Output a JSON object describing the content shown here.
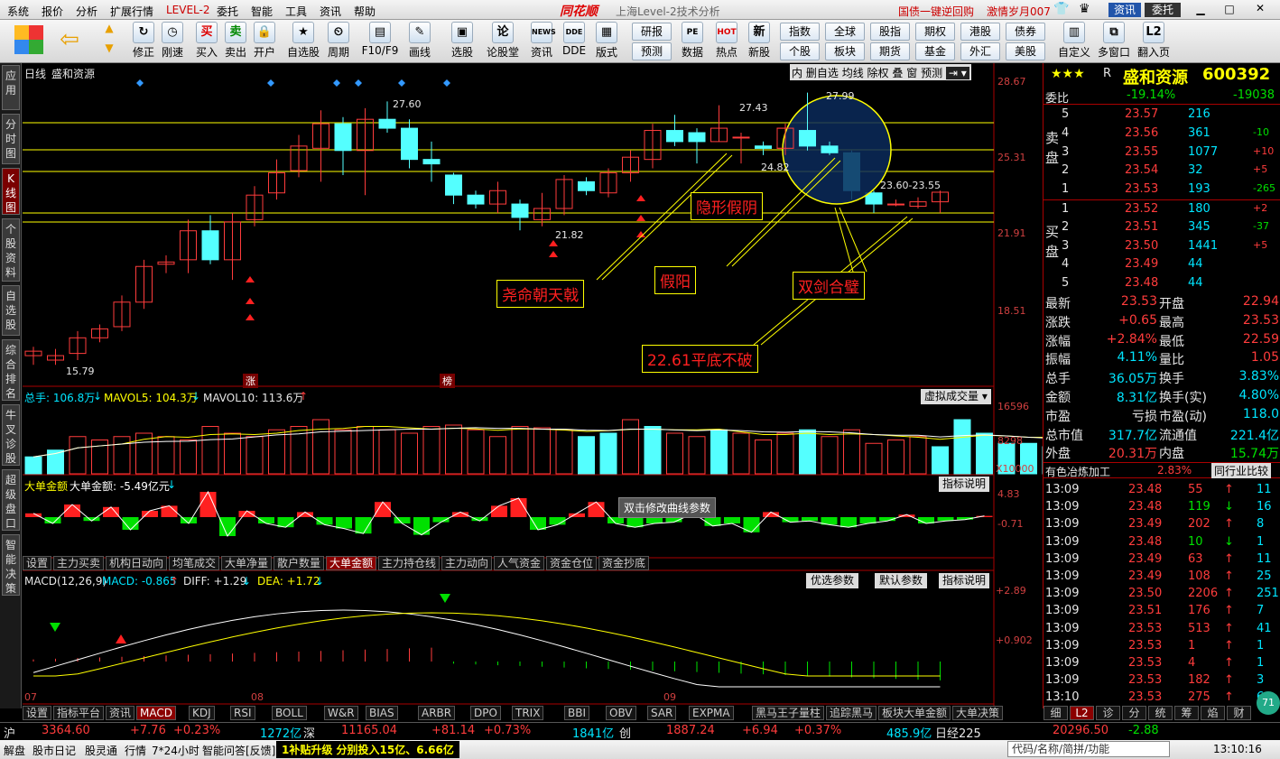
{
  "menubar": {
    "items": [
      "系统",
      "报价",
      "分析",
      "扩展行情",
      "LEVEL-2",
      "委托",
      "智能",
      "工具",
      "资讯",
      "帮助"
    ],
    "brand": "同花顺",
    "window_title": "上海Level-2技术分析",
    "promo1": "国债一键逆回购",
    "promo2": "激情岁月007",
    "btn_info": "资讯",
    "btn_trade": "委托"
  },
  "toolbar": {
    "buttons": [
      "修正",
      "刚速",
      "买入",
      "卖出",
      "开户",
      "自选股",
      "周期",
      "F10/F9",
      "画线",
      "选股",
      "论股堂",
      "资讯",
      "DDE",
      "版式",
      "数据",
      "热点",
      "新股"
    ],
    "small_buttons": [
      "研报",
      "预测",
      "指数",
      "全球",
      "股指",
      "期权",
      "港股",
      "债券",
      "个股",
      "板块",
      "期货",
      "基金",
      "外汇",
      "美股"
    ],
    "right_buttons": [
      "自定义",
      "多窗口",
      "翻入页"
    ]
  },
  "sidetabs": [
    "应用",
    "分时图",
    "K线图",
    "个股资料",
    "自选股",
    "综合排名",
    "牛叉诊股",
    "超级盘口",
    "智能决策"
  ],
  "kchart": {
    "period_label": "日线",
    "stock_name": "盛和资源",
    "top_buttons": [
      "内",
      "删自选",
      "均线",
      "除权",
      "叠",
      "窗",
      "预测"
    ],
    "y_ticks": [
      "28.67",
      "25.31",
      "21.91",
      "18.51"
    ],
    "price_labels": [
      "27.60",
      "27.43",
      "27.99",
      "24.82",
      "21.82",
      "15.79",
      "23.60-23.55"
    ],
    "markers": [
      "涨",
      "榜"
    ],
    "annotations": [
      "隐形假阴",
      "尧命朝天戟",
      "假阳",
      "双剑合璧",
      "22.61平底不破"
    ]
  },
  "volume": {
    "label": "总手: 106.8万",
    "mavol5": "MAVOL5: 104.3万",
    "mavol10": "MAVOL10: 113.6万",
    "button": "虚拟成交量",
    "y_ticks": [
      "16596",
      "8298",
      "X10000"
    ],
    "values": [
      2.5,
      3.5,
      5.5,
      5.0,
      5.5,
      6.0,
      5.5,
      5.0,
      7.0,
      6.0,
      5.5,
      6.5,
      7.0,
      8.0,
      6.5,
      7.0,
      6.5,
      6.0,
      7.0,
      7.2,
      6.5,
      5.5,
      7.0,
      6.8,
      6.5,
      5.5,
      6.0,
      8.0,
      7.0,
      6.0,
      5.5,
      6.5,
      6.0,
      5.0,
      6.0,
      6.5,
      5.5,
      6.5,
      4.5,
      5.0,
      5.5,
      4.0,
      8.0,
      6.0,
      4.5,
      4.5,
      4.0,
      2.5,
      2.5,
      2.0
    ],
    "colors": [
      "c",
      "c",
      "r",
      "r",
      "r",
      "r",
      "r",
      "r",
      "r",
      "r",
      "r",
      "r",
      "r",
      "r",
      "r",
      "r",
      "r",
      "r",
      "r",
      "r",
      "r",
      "r",
      "r",
      "r",
      "r",
      "c",
      "c",
      "r",
      "c",
      "r",
      "r",
      "c",
      "r",
      "r",
      "r",
      "c",
      "r",
      "r",
      "r",
      "r",
      "r",
      "c",
      "c",
      "c",
      "c",
      "c",
      "c",
      "c",
      "r",
      "r"
    ]
  },
  "bigorder": {
    "label": "大单金额",
    "value": "大单金额: -5.49亿元",
    "button": "指标说明",
    "y_ticks": [
      "4.83",
      "-0.71"
    ],
    "tooltip": "双击修改曲线参数",
    "values": [
      0.3,
      -0.5,
      1.0,
      -0.3,
      0.8,
      -1.0,
      0.5,
      0.9,
      -0.5,
      2.0,
      -1.5,
      0.5,
      -0.5,
      -0.8,
      0.4,
      -0.6,
      -0.9,
      -1.3,
      1.2,
      -0.5,
      -1.4,
      -0.4,
      0.4,
      -0.3,
      0.9,
      1.5,
      -1.0,
      -0.6,
      0.3,
      1.2,
      -0.5,
      -0.8,
      -0.5,
      -0.4,
      0.3,
      -0.7,
      -0.5,
      -1.2,
      0.4,
      -0.4,
      -0.3,
      -0.6,
      -0.8,
      -0.5,
      -0.3,
      0.2,
      -0.5,
      -0.3,
      -0.2,
      0.1
    ],
    "tabs": [
      "设置",
      "主力买卖",
      "机构日动向",
      "均笔成交",
      "大单净量",
      "散户数量",
      "大单金额",
      "主力持仓线",
      "主力动向",
      "人气资金",
      "资金仓位",
      "资金抄底"
    ]
  },
  "macd": {
    "label": "MACD(12,26,9)",
    "macd": "MACD: -0.865",
    "diff": "DIFF: +1.29",
    "dea": "DEA: +1.72",
    "buttons": [
      "优选参数",
      "默认参数",
      "指标说明"
    ],
    "y_ticks": [
      "+2.89",
      "+0.902"
    ],
    "dates": [
      "07",
      "08",
      "09"
    ],
    "tabs": [
      "设置",
      "指标平台",
      "资讯",
      "MACD",
      "KDJ",
      "RSI",
      "BOLL",
      "W&R",
      "BIAS",
      "ARBR",
      "DPO",
      "TRIX",
      "BBI",
      "OBV",
      "SAR",
      "EXPMA",
      "黑马王子量柱",
      "追踪黑马",
      "板块大单金额",
      "大单决策"
    ]
  },
  "quote": {
    "stars": "★★★",
    "r": "R",
    "name": "盛和资源",
    "code": "600392",
    "weibi_label": "委比",
    "weibi_pct": "-19.14%",
    "weibi_val": "-19038",
    "sell_label": "卖盘",
    "buy_label": "买盘",
    "sells": [
      [
        "5",
        "23.57",
        "216",
        ""
      ],
      [
        "4",
        "23.56",
        "361",
        "-10"
      ],
      [
        "3",
        "23.55",
        "1077",
        "+10"
      ],
      [
        "2",
        "23.54",
        "32",
        "+5"
      ],
      [
        "1",
        "23.53",
        "193",
        "-265"
      ]
    ],
    "buys": [
      [
        "1",
        "23.52",
        "180",
        "+2"
      ],
      [
        "2",
        "23.51",
        "345",
        "-37"
      ],
      [
        "3",
        "23.50",
        "1441",
        "+5"
      ],
      [
        "4",
        "23.49",
        "44",
        ""
      ],
      [
        "5",
        "23.48",
        "44",
        ""
      ]
    ],
    "stats": [
      [
        "最新",
        "23.53",
        "开盘",
        "22.94"
      ],
      [
        "涨跌",
        "+0.65",
        "最高",
        "23.53"
      ],
      [
        "涨幅",
        "+2.84%",
        "最低",
        "22.59"
      ],
      [
        "振幅",
        "4.11%",
        "量比",
        "1.05"
      ],
      [
        "总手",
        "36.05万",
        "换手",
        "3.83%"
      ],
      [
        "金额",
        "8.31亿",
        "换手(实)",
        "4.80%"
      ],
      [
        "市盈",
        "亏损",
        "市盈(动)",
        "118.0"
      ],
      [
        "总市值",
        "317.7亿",
        "流通值",
        "221.4亿"
      ],
      [
        "外盘",
        "20.31万",
        "内盘",
        "15.74万"
      ]
    ],
    "industry": "有色冶炼加工",
    "industry_pct": "2.83%",
    "compare_btn": "同行业比较",
    "ticks": [
      [
        "13:09",
        "23.48",
        "55",
        "11"
      ],
      [
        "13:09",
        "23.48",
        "119",
        "16"
      ],
      [
        "13:09",
        "23.49",
        "202",
        "8"
      ],
      [
        "13:09",
        "23.48",
        "10",
        "1"
      ],
      [
        "13:09",
        "23.49",
        "63",
        "11"
      ],
      [
        "13:09",
        "23.49",
        "108",
        "25"
      ],
      [
        "13:09",
        "23.50",
        "2206",
        "251"
      ],
      [
        "13:09",
        "23.51",
        "176",
        "7"
      ],
      [
        "13:09",
        "23.53",
        "513",
        "41"
      ],
      [
        "13:09",
        "23.53",
        "1",
        "1"
      ],
      [
        "13:09",
        "23.53",
        "4",
        "1"
      ],
      [
        "13:09",
        "23.53",
        "182",
        "3"
      ],
      [
        "13:10",
        "23.53",
        "275",
        "6"
      ]
    ],
    "bottom_tabs": [
      "细",
      "L2",
      "诊",
      "分",
      "统",
      "筹",
      "焰",
      "财"
    ],
    "badge": "71"
  },
  "statusbar": {
    "sh_label": "沪",
    "sh_val": "3364.60",
    "sh_chg": "+7.76",
    "sh_pct": "+0.23%",
    "sh_amt": "1272亿",
    "sz_label": "深",
    "sz_val": "11165.04",
    "sz_chg": "+81.14",
    "sz_pct": "+0.73%",
    "sz_amt": "1841亿",
    "cy_label": "创",
    "cy_val": "1887.24",
    "cy_chg": "+6.94",
    "cy_pct": "+0.37%",
    "cy_amt": "485.9亿",
    "nk_label": "日经225",
    "nk_val": "20296.50",
    "nk_chg": "-2.88"
  },
  "statusbar2": {
    "items": [
      "解盘",
      "股市日记",
      "股灵通",
      "行情",
      "7*24小时",
      "智能问答[反馈]"
    ],
    "notice": "1补贴升级 分别投入15亿、6.66亿",
    "search_placeholder": "代码/名称/简拼/功能",
    "time": "13:10:16"
  }
}
